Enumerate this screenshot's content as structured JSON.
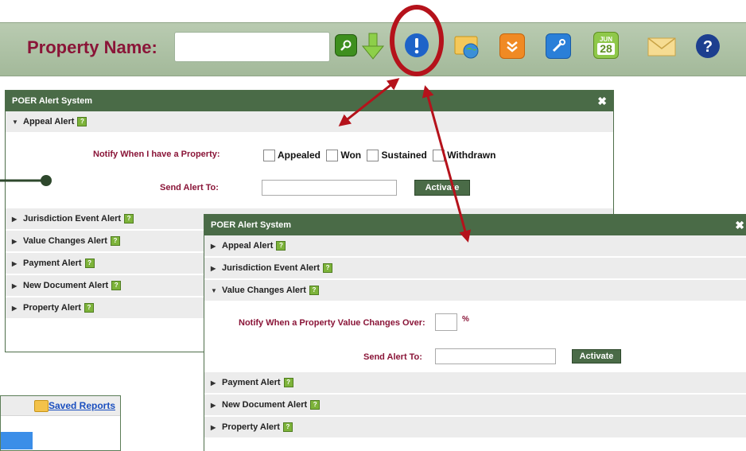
{
  "toolbar": {
    "property_label": "Property Name:",
    "property_value": "",
    "icons": [
      "search-icon",
      "download-arrow-icon",
      "alert-icon",
      "folder-globe-icon",
      "collapse-icon",
      "tools-icon",
      "calendar-icon",
      "mail-icon",
      "help-icon"
    ],
    "calendar_month": "JUN",
    "calendar_day": "28"
  },
  "dialog1": {
    "title": "POER Alert System",
    "close": "✖",
    "expanded": {
      "label": "Appeal Alert",
      "notify_label": "Notify When I have a Property:",
      "options": [
        "Appealed",
        "Won",
        "Sustained",
        "Withdrawn"
      ],
      "send_label": "Send Alert To:",
      "send_value": "",
      "activate": "Activate"
    },
    "collapsed": [
      "Jurisdiction Event Alert",
      "Value Changes Alert",
      "Payment Alert",
      "New Document Alert",
      "Property Alert"
    ]
  },
  "dialog2": {
    "title": "POER Alert System",
    "close": "✖",
    "before": [
      "Appeal Alert",
      "Jurisdiction Event Alert"
    ],
    "expanded": {
      "label": "Value Changes Alert",
      "notify_label": "Notify When a Property Value Changes Over:",
      "percent_value": "",
      "percent_symbol": "%",
      "send_label": "Send Alert To:",
      "send_value": "",
      "activate": "Activate"
    },
    "after": [
      "Payment Alert",
      "New Document Alert",
      "Property Alert"
    ]
  },
  "saved_reports": {
    "label": "Saved Reports"
  },
  "help_glyph": "?",
  "colors": {
    "header_green": "#4a6b47",
    "label_red": "#8a1538",
    "annotation_red": "#b5121b",
    "toolbar_green": "#a3b99a"
  }
}
